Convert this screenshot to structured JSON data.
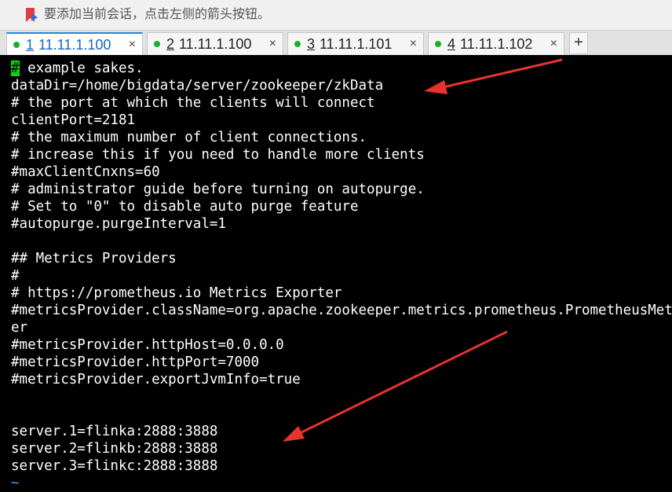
{
  "hint": {
    "text": "要添加当前会话，点击左侧的箭头按钮。"
  },
  "tabs": [
    {
      "num": "1",
      "host": "11.11.1.100",
      "close": "×"
    },
    {
      "num": "2",
      "host": "11.11.1.100",
      "close": "×"
    },
    {
      "num": "3",
      "host": "11.11.1.101",
      "close": "×"
    },
    {
      "num": "4",
      "host": "11.11.1.102",
      "close": "×"
    }
  ],
  "tab_add": "+",
  "terminal": {
    "first_line": {
      "cursor": "#",
      "rest": " example sakes."
    },
    "lines": [
      "dataDir=/home/bigdata/server/zookeeper/zkData",
      "# the port at which the clients will connect",
      "clientPort=2181",
      "# the maximum number of client connections.",
      "# increase this if you need to handle more clients",
      "#maxClientCnxns=60",
      "# administrator guide before turning on autopurge.",
      "# Set to \"0\" to disable auto purge feature",
      "#autopurge.purgeInterval=1",
      "",
      "## Metrics Providers",
      "#",
      "# https://prometheus.io Metrics Exporter",
      "#metricsProvider.className=org.apache.zookeeper.metrics.prometheus.PrometheusMetricsProviderWrapp",
      "er",
      "#metricsProvider.httpHost=0.0.0.0",
      "#metricsProvider.httpPort=7000",
      "#metricsProvider.exportJvmInfo=true",
      "",
      "",
      "server.1=flinka:2888:3888",
      "server.2=flinkb:2888:3888",
      "server.3=flinkc:2888:3888"
    ],
    "tilde": "~"
  },
  "colors": {
    "accent": "#1e88e5",
    "cursor": "#14d014",
    "arrow": "#e8322e",
    "status_dot": "#17b12a"
  }
}
